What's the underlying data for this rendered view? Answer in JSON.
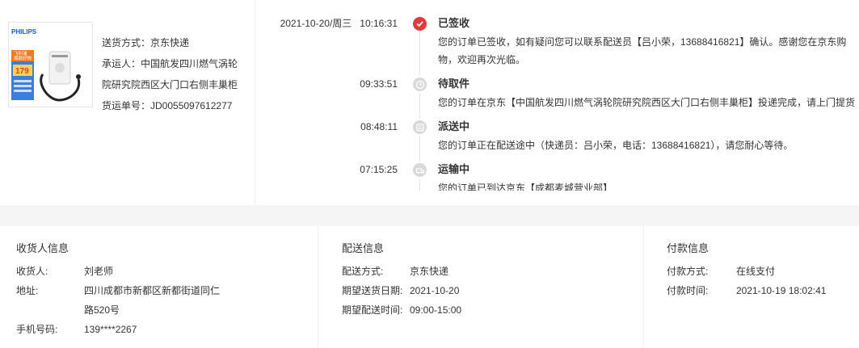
{
  "product": {
    "brand": "PHILIPS",
    "promo_line1": "飞利浦",
    "promo_line2": "爆款好物",
    "price": "179",
    "icon": "portable-speaker-product-image"
  },
  "shipping": {
    "method": "送货方式：京东快递",
    "carrier": "承运人：中国航发四川燃气涡轮院研究院西区大门口右侧丰巢柜",
    "carrier_line1": "承运人：中国航发四川燃气涡轮",
    "carrier_line2": "院研究院西区大门口右侧丰巢柜",
    "tracking": "货运单号：JD0055097612277"
  },
  "timeline": [
    {
      "date_time": "2021-10-20/周三   10:16:31",
      "title": "已签收",
      "desc": "您的订单已签收，如有疑问您可以联系配送员【吕小荣，13688416821】确认。感谢您在京东购物，欢迎再次光临。",
      "icon": "check-icon",
      "active": true
    },
    {
      "date_time": "09:33:51",
      "title": "待取件",
      "desc": "您的订单在京东【中国航发四川燃气涡轮院研究院西区大门口右侧丰巢柜】投递完成，请上门提货",
      "icon": "clock-icon"
    },
    {
      "date_time": "08:48:11",
      "title": "派送中",
      "desc": "您的订单正在配送途中（快递员：吕小荣，电话：13688416821），请您耐心等待。",
      "icon": "courier-icon"
    },
    {
      "date_time": "07:15:25",
      "title": "运输中",
      "desc": "您的订单已到达京东【成都麦城营业部】",
      "icon": "truck-icon"
    }
  ],
  "receiver": {
    "title": "收货人信息",
    "name_label": "收货人:",
    "name": "刘老师",
    "address_label": "地址:",
    "address_line1": "四川成都市新都区新都街道同仁",
    "address_line2": "路520号",
    "phone_label": "手机号码:",
    "phone": "139****2267"
  },
  "delivery": {
    "title": "配送信息",
    "method_label": "配送方式:",
    "method": "京东快递",
    "date_label": "期望送货日期:",
    "date": "2021-10-20",
    "time_label": "期望配送时间:",
    "time": "09:00-15:00"
  },
  "payment": {
    "title": "付款信息",
    "method_label": "付款方式:",
    "method": "在线支付",
    "time_label": "付款时间:",
    "time": "2021-10-19 18:02:41"
  },
  "colors": {
    "accent": "#e4393c",
    "inactive_icon": "#d9d9d9",
    "band": "#f5f5f5",
    "divider": "#eeeeee",
    "promo_orange": "#f47a20",
    "promo_blue": "#3a7ee0"
  }
}
